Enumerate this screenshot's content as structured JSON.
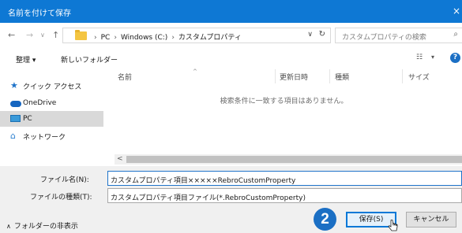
{
  "window": {
    "title": "名前を付けて保存",
    "close_glyph": "×"
  },
  "address_bar": {
    "back_glyph": "←",
    "forward_glyph": "→",
    "recent_glyph": "∨",
    "up_glyph": "↑",
    "breadcrumb": [
      "PC",
      "Windows (C:)",
      "カスタムプロパティ"
    ],
    "sep_glyph": "›",
    "dropdown_glyph": "∨",
    "refresh_glyph": "↻"
  },
  "search": {
    "placeholder": "カスタムプロパティの検索",
    "icon": "search-icon",
    "glyph": "⌕"
  },
  "toolbar": {
    "organize_label": "整理 ▾",
    "new_folder_label": "新しいフォルダー",
    "view_glyph": "☷",
    "view_dropdown": "▾",
    "help_label": "?"
  },
  "nav_pane": {
    "items": [
      {
        "label": "クイック アクセス",
        "icon": "star-icon",
        "glyph": "★"
      },
      {
        "label": "OneDrive",
        "icon": "cloud-icon",
        "glyph": ""
      },
      {
        "label": "PC",
        "icon": "computer-icon",
        "glyph": "",
        "selected": true
      },
      {
        "label": "ネットワーク",
        "icon": "network-icon",
        "glyph": "⌂"
      }
    ]
  },
  "file_list": {
    "columns": [
      "名前",
      "更新日時",
      "種類",
      "サイズ"
    ],
    "sort_glyph": "^",
    "empty_message": "検索条件に一致する項目はありません。",
    "scroll_left_glyph": "<"
  },
  "form": {
    "filename_label": "ファイル名(N):",
    "filename_value": "カスタムプロパティ項目×××××RebroCustomProperty",
    "filetype_label": "ファイルの種類(T):",
    "filetype_value": "カスタムプロパティ項目ファイル(*.RebroCustomProperty)",
    "hide_folders_label": "フォルダーの非表示",
    "hide_folders_glyph": "∧"
  },
  "buttons": {
    "save_label": "保存(S)",
    "cancel_label": "キャンセル"
  },
  "annotation": {
    "step_number": "2",
    "color": "#1b6fc4"
  },
  "colors": {
    "title_bar": "#0e78d4",
    "accent": "#0078d7",
    "selection": "#d9d9d9"
  }
}
